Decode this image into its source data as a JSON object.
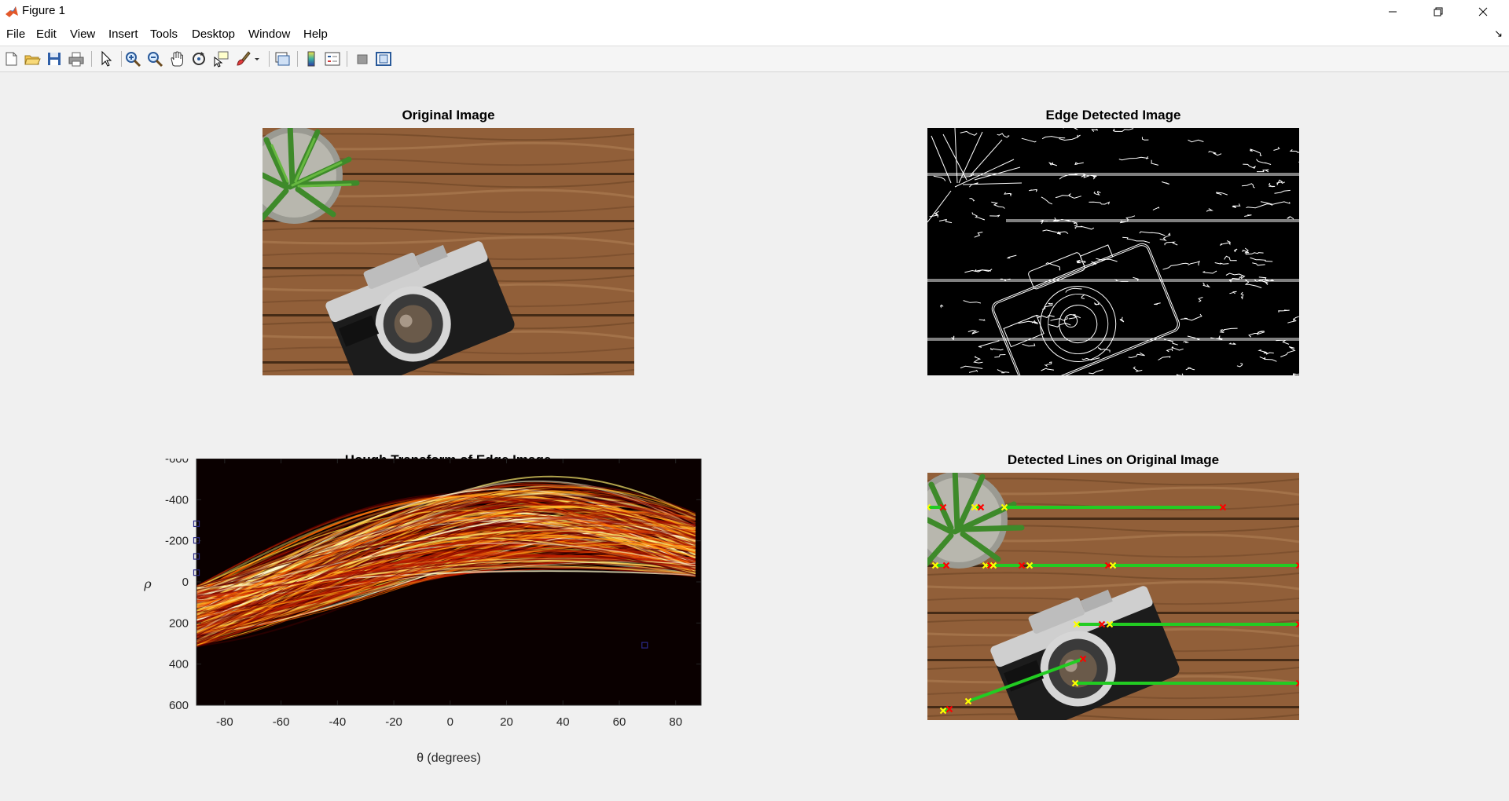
{
  "window": {
    "title": "Figure 1"
  },
  "menu": [
    "File",
    "Edit",
    "View",
    "Insert",
    "Tools",
    "Desktop",
    "Window",
    "Help"
  ],
  "toolbar_icons": [
    "new-figure-icon",
    "open-file-icon",
    "save-icon",
    "print-icon",
    "select-arrow-icon",
    "zoom-in-icon",
    "zoom-out-icon",
    "pan-hand-icon",
    "rotate-3d-icon",
    "data-tips-icon",
    "brush-icon",
    "link-plot-icon",
    "colorbar-icon",
    "legend-icon",
    "hide-plot-tools-icon",
    "show-plot-tools-icon"
  ],
  "subplots": {
    "original": {
      "title": "Original Image"
    },
    "edges": {
      "title": "Edge Detected Image"
    },
    "hough": {
      "title": "Hough Transform of Edge Image",
      "xlabel": "θ (degrees)",
      "ylabel": "ρ"
    },
    "lines": {
      "title": "Detected Lines on Original Image"
    }
  },
  "chart_data": {
    "type": "heatmap",
    "title": "Hough Transform of Edge Image",
    "xlabel": "θ (degrees)",
    "ylabel": "ρ",
    "xlim": [
      -90,
      89
    ],
    "ylim": [
      -600,
      600
    ],
    "y_reversed": true,
    "xticks": [
      -80,
      -60,
      -40,
      -20,
      0,
      20,
      40,
      60,
      80
    ],
    "yticks": [
      -600,
      -400,
      -200,
      0,
      200,
      400,
      600
    ],
    "colormap": "hot",
    "peaks": [
      {
        "theta": -90,
        "rho": -283
      },
      {
        "theta": -90,
        "rho": -202
      },
      {
        "theta": -90,
        "rho": -124
      },
      {
        "theta": -90,
        "rho": -45
      },
      {
        "theta": 69,
        "rho": 308
      }
    ]
  },
  "colors": {
    "line": "#22cc22",
    "start_marker": "#ffff00",
    "end_marker": "#ff0000"
  }
}
